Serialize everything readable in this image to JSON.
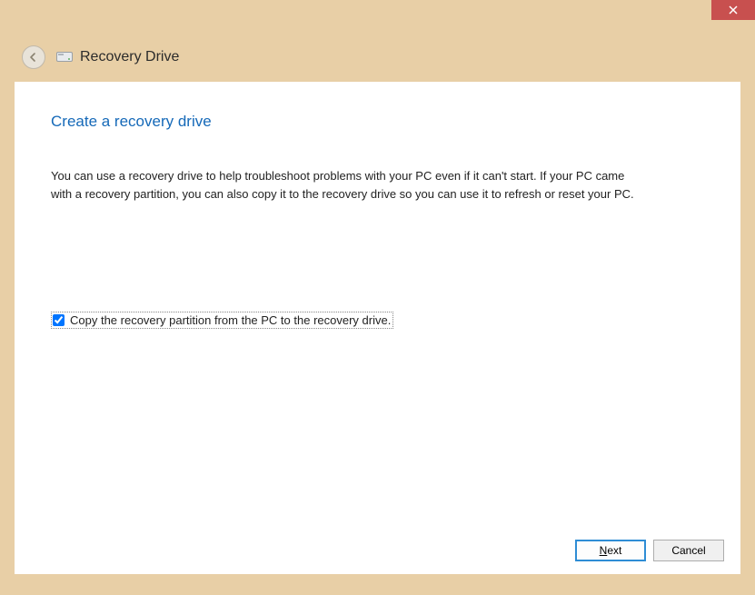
{
  "window": {
    "title": "Recovery Drive"
  },
  "page": {
    "heading": "Create a recovery drive",
    "description": "You can use a recovery drive to help troubleshoot problems with your PC even if it can't start. If your PC came with a recovery partition, you can also copy it to the recovery drive so you can use it to refresh or reset your PC."
  },
  "checkbox": {
    "label": "Copy the recovery partition from the PC to the recovery drive.",
    "checked": true
  },
  "buttons": {
    "next_prefix": "N",
    "next_rest": "ext",
    "cancel": "Cancel"
  }
}
